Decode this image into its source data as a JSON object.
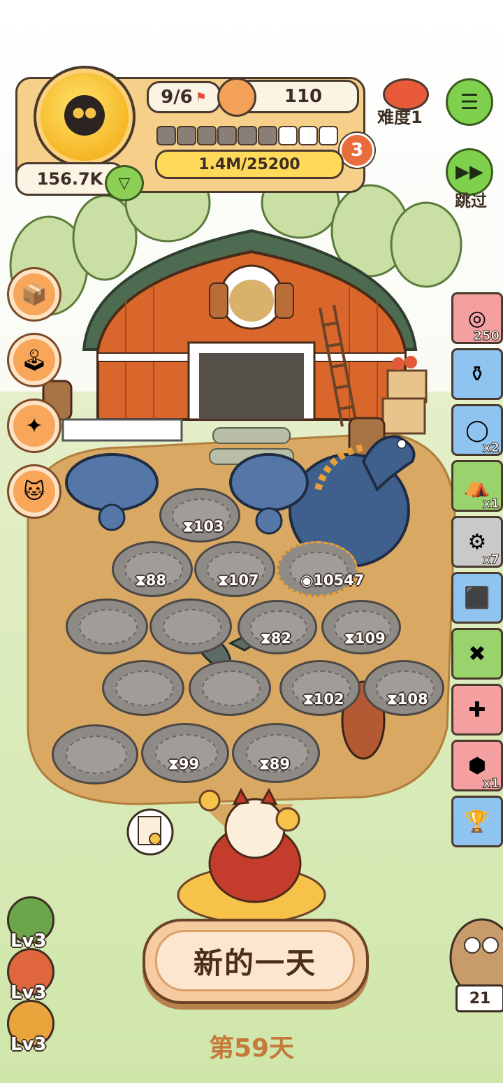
{
  "hud": {
    "flags": "9/6",
    "food": "110",
    "difficulty": "难度1",
    "coins": "156.7K",
    "progress_text": "1.4M/25200",
    "level": "3",
    "segments_filled": 6,
    "segments_total": 9
  },
  "skip_label": "跳过",
  "left_tools": [
    {
      "icon": "box-icon"
    },
    {
      "icon": "joystick-icon"
    },
    {
      "icon": "wand-icon"
    },
    {
      "icon": "lucky-cat-icon"
    }
  ],
  "right_items": [
    {
      "icon": "fossil-icon",
      "count": "250",
      "color": "#f4a0a0"
    },
    {
      "icon": "jar-icon",
      "count": "",
      "color": "#8fc3f0"
    },
    {
      "icon": "ring-icon",
      "count": "x2",
      "color": "#8fc3f0"
    },
    {
      "icon": "tent-icon",
      "count": "x1",
      "color": "#9ad36d"
    },
    {
      "icon": "tool-icon",
      "count": "x7",
      "color": "#c9c9c9"
    },
    {
      "icon": "armor-icon",
      "count": "",
      "color": "#8fc3f0"
    },
    {
      "icon": "map-icon",
      "count": "",
      "color": "#9ad36d"
    },
    {
      "icon": "paw-plus-icon",
      "count": "",
      "color": "#f4a0a0"
    },
    {
      "icon": "shell-icon",
      "count": "x1",
      "color": "#f4a0a0"
    },
    {
      "icon": "trophy-icon",
      "count": "",
      "color": "#8fc3f0"
    }
  ],
  "plots": [
    {
      "timer": "103"
    },
    {
      "timer": "88"
    },
    {
      "timer": "107"
    },
    {
      "timer": "10547"
    },
    {
      "timer": "82"
    },
    {
      "timer": "109"
    },
    {
      "timer": "102"
    },
    {
      "timer": "108"
    },
    {
      "timer": "99"
    },
    {
      "timer": "89"
    }
  ],
  "levels": [
    {
      "label": "Lv3",
      "color": "#6aa64a"
    },
    {
      "label": "Lv3",
      "color": "#e0663d"
    },
    {
      "label": "Lv3",
      "color": "#e9a43c"
    }
  ],
  "new_day_button": "新的一天",
  "day_label": "第59天",
  "owl_count": "21"
}
